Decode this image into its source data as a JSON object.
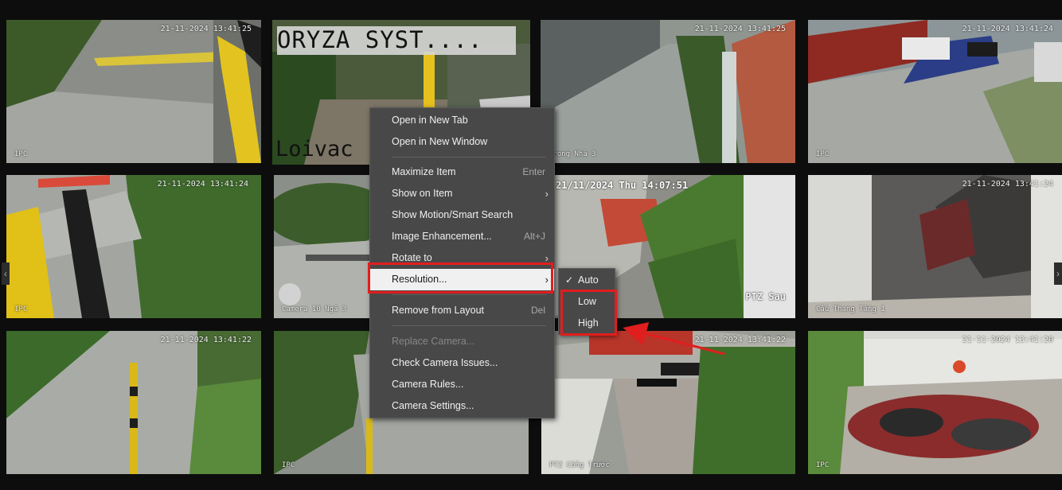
{
  "tiles": [
    {
      "timestamp": "21-11-2024 13:41:25",
      "label": "IPC"
    },
    {
      "timestamp": "",
      "label": "",
      "overlay_title": "ORYZA SYST....",
      "overlay_bottom": "Loivac"
    },
    {
      "timestamp": "21-11-2024 13:41:25",
      "label": "Trong Nhà 3"
    },
    {
      "timestamp": "21-11-2024 13:41:24",
      "label": "IPC"
    },
    {
      "timestamp": "21-11-2024 13:41:24",
      "label": "IPC"
    },
    {
      "timestamp": "",
      "label": "Camera 10  Ngã 3"
    },
    {
      "timestamp": "21/11/2024 Thu 14:07:51",
      "label": "PTZ Sau"
    },
    {
      "timestamp": "21-11-2024 13:41:24",
      "label": "Cầu Thang Tầng 1"
    },
    {
      "timestamp": "21-11-2024 13:41:22",
      "label": ""
    },
    {
      "timestamp": "",
      "label": "IPC"
    },
    {
      "timestamp": "21-11-2024 13:41:22",
      "label": "PTZ Cổng Trước"
    },
    {
      "timestamp": "21-11-2024 13:41:20",
      "label": "IPC"
    }
  ],
  "context_menu": {
    "items": [
      {
        "label": "Open in New Tab",
        "shortcut": "",
        "submenu": false,
        "disabled": false
      },
      {
        "label": "Open in New Window",
        "shortcut": "",
        "submenu": false,
        "disabled": false
      },
      {
        "label": "Maximize Item",
        "shortcut": "Enter",
        "submenu": false,
        "disabled": false
      },
      {
        "label": "Show on Item",
        "shortcut": "",
        "submenu": true,
        "disabled": false
      },
      {
        "label": "Show Motion/Smart Search",
        "shortcut": "",
        "submenu": false,
        "disabled": false
      },
      {
        "label": "Image Enhancement...",
        "shortcut": "Alt+J",
        "submenu": false,
        "disabled": false
      },
      {
        "label": "Rotate to",
        "shortcut": "",
        "submenu": true,
        "disabled": false
      },
      {
        "label": "Resolution...",
        "shortcut": "",
        "submenu": true,
        "disabled": false,
        "hovered": true
      },
      {
        "label": "Remove from Layout",
        "shortcut": "Del",
        "submenu": false,
        "disabled": false
      },
      {
        "label": "Replace Camera...",
        "shortcut": "",
        "submenu": false,
        "disabled": true
      },
      {
        "label": "Check Camera Issues...",
        "shortcut": "",
        "submenu": false,
        "disabled": false
      },
      {
        "label": "Camera Rules...",
        "shortcut": "",
        "submenu": false,
        "disabled": false
      },
      {
        "label": "Camera Settings...",
        "shortcut": "",
        "submenu": false,
        "disabled": false
      }
    ]
  },
  "resolution_submenu": {
    "items": [
      {
        "label": "Auto",
        "checked": true
      },
      {
        "label": "Low",
        "checked": false
      },
      {
        "label": "High",
        "checked": false
      }
    ]
  },
  "colors": {
    "menu_bg": "#484848",
    "menu_hover_bg": "#f0f0f0",
    "annotation_red": "#e01e1e"
  },
  "icons": {
    "submenu_arrow": "chevron-right-icon",
    "check": "checkmark-icon",
    "left_nav": "chevron-left-icon",
    "right_nav": "chevron-right-icon"
  }
}
